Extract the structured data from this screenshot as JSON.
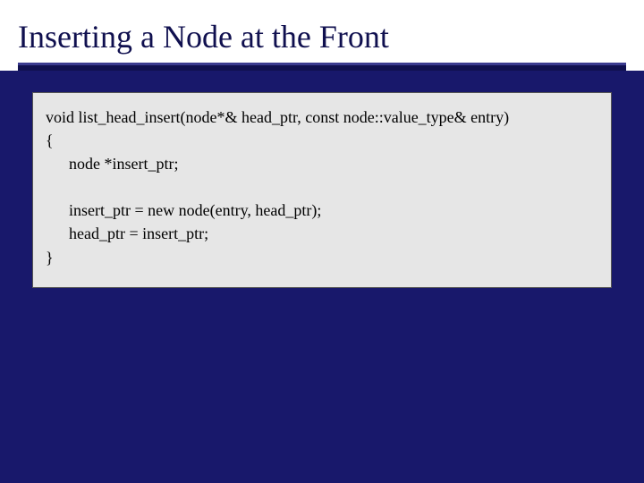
{
  "title": "Inserting a Node at the Front",
  "code": {
    "l1": "void list_head_insert(node*& head_ptr, const node::value_type& entry)",
    "l2": "{",
    "l3": "node *insert_ptr;",
    "l4": "insert_ptr = new node(entry, head_ptr);",
    "l5": "head_ptr = insert_ptr;",
    "l6": "}"
  }
}
